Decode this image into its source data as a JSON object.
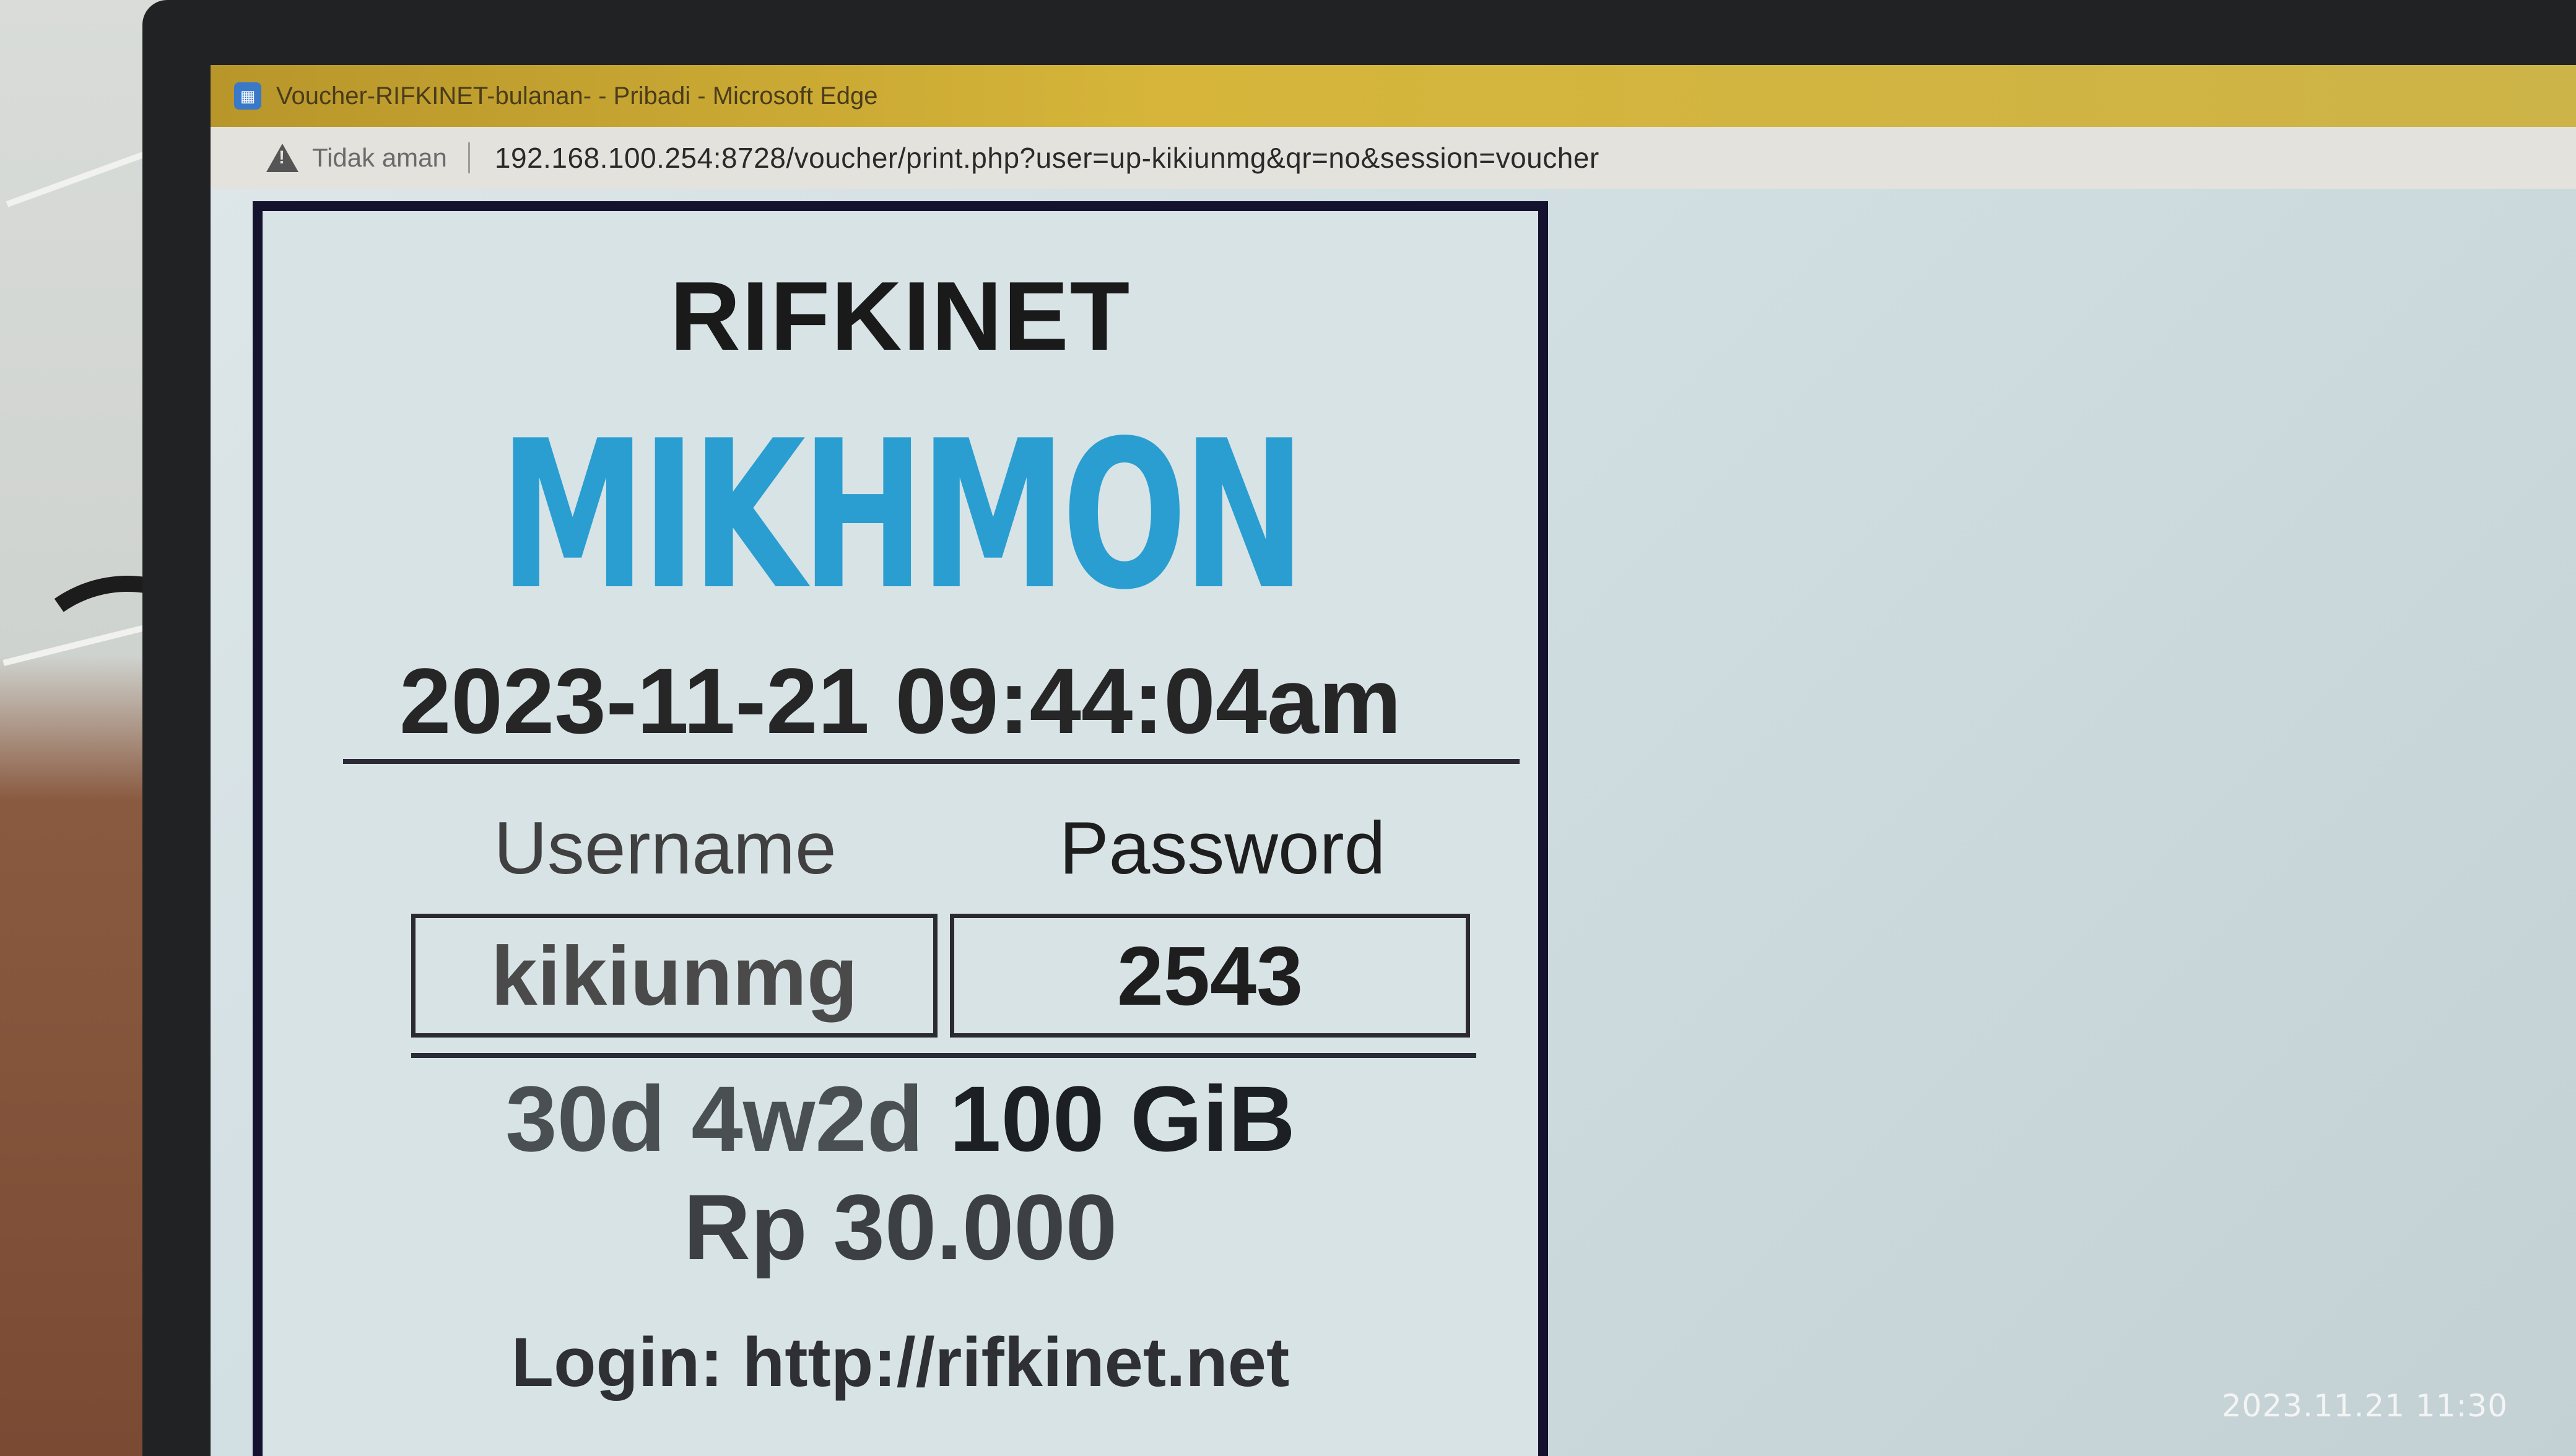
{
  "browser": {
    "window_title": "Voucher-RIFKINET-bulanan- - Pribadi - Microsoft Edge",
    "security_label": "Tidak aman",
    "url": "192.168.100.254:8728/voucher/print.php?user=up-kikiunmg&qr=no&session=voucher"
  },
  "voucher": {
    "brand": "RIFKINET",
    "logo_text": "MIKHMON",
    "datetime": "2023-11-21 09:44:04am",
    "username_label": "Username",
    "password_label": "Password",
    "username": "kikiunmg",
    "password": "2543",
    "validity": "30d 4w2d",
    "quota": "100 GiB",
    "price": "Rp 30.000",
    "login": "Login: http://rifkinet.net"
  },
  "photo_timestamp": "2023.11.21 11:30",
  "colors": {
    "titlebar": "#d6b53a",
    "logo": "#2a9ed0",
    "voucher_border": "#14122e",
    "page_background": "#d2dfe3"
  },
  "icons": {
    "app": "edge-page-icon",
    "security": "warning-triangle-icon"
  }
}
